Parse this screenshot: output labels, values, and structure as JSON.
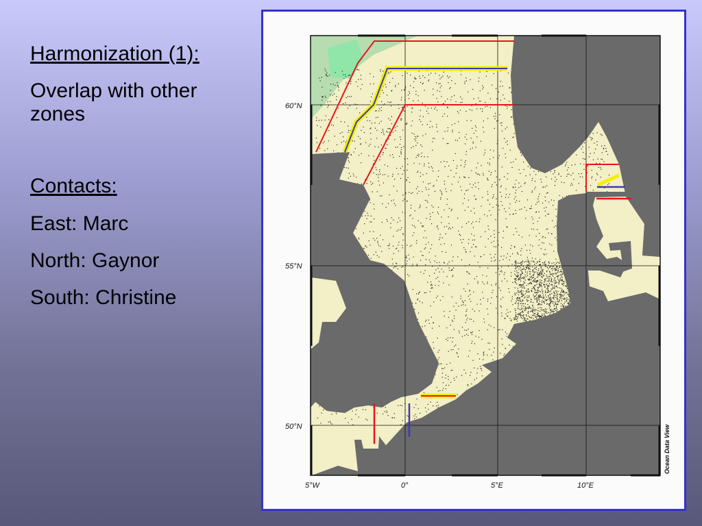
{
  "slide": {
    "title": "Harmonization (1):",
    "subtitle_line1": "Overlap with other",
    "subtitle_line2": "zones",
    "contacts_heading": "Contacts:",
    "contacts": [
      "East: Marc",
      "North: Gaynor",
      "South: Christine"
    ]
  },
  "map": {
    "lat_labels": [
      "60°N",
      "55°N",
      "50°N"
    ],
    "lon_labels": [
      "5°W",
      "0°",
      "5°E",
      "10°E"
    ],
    "credit": "Ocean Data View",
    "colors": {
      "sea": "#f3efc6",
      "land": "#6a6a6a",
      "green_zone": "#a8e0b4",
      "red_line": "#e8141c",
      "yellow_line": "#f4f000",
      "blue_line": "#3a3ab8",
      "border": "#3434c8"
    }
  }
}
